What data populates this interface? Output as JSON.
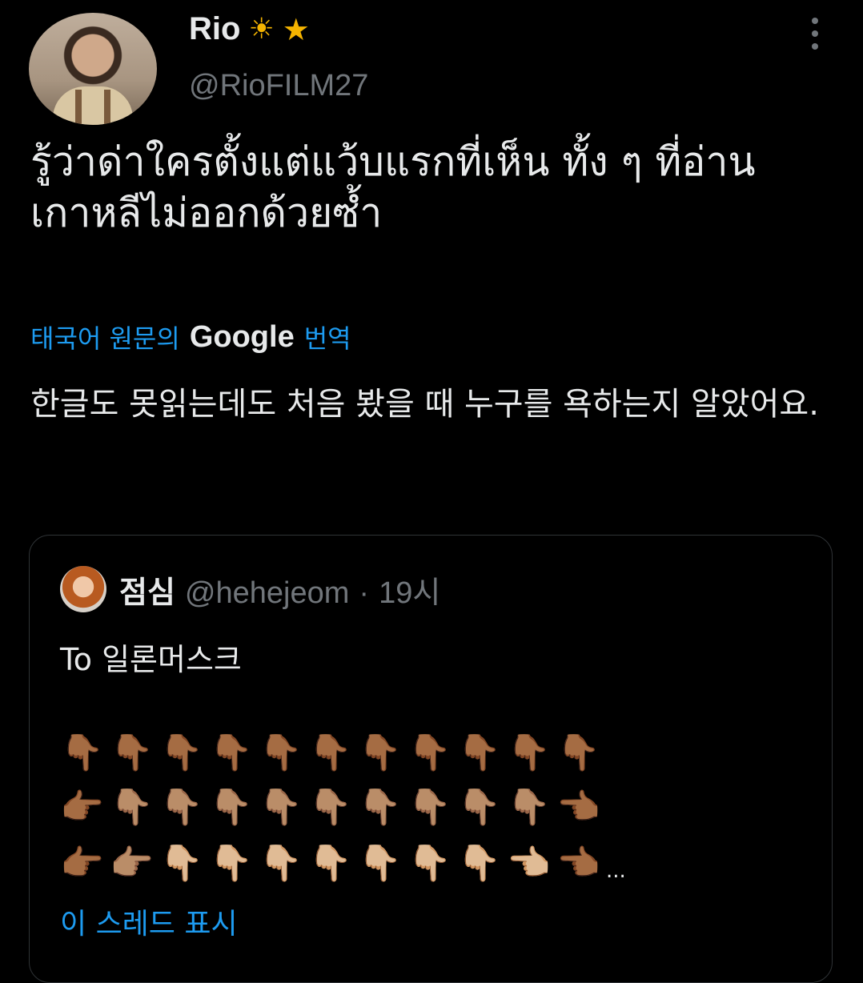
{
  "author": {
    "name": "Rio",
    "emoji_1": "☀",
    "emoji_2": "★",
    "handle": "@RioFILM27"
  },
  "tweet": {
    "text": "รู้ว่าด่าใครตั้งแต่แว้บแรกที่เห็น ทั้ง ๆ ที่อ่านเกาหลีไม่ออกด้วยซ้ำ",
    "translate_prefix": "태국어 원문의",
    "translate_brand": "Google",
    "translate_suffix": "번역",
    "translation": "한글도 못읽는데도 처음 봤을 때 누구를 욕하는지 알았어요."
  },
  "quoted": {
    "name": "점심",
    "handle": "@hehejeom",
    "separator": "·",
    "time": "19시",
    "text": "To 일론머스크",
    "emoji_rows": [
      [
        "👇🏾",
        "👇🏾",
        "👇🏾",
        "👇🏾",
        "👇🏾",
        "👇🏾",
        "👇🏾",
        "👇🏾",
        "👇🏾",
        "👇🏾",
        "👇🏾"
      ],
      [
        "👉🏾",
        "👇🏽",
        "👇🏽",
        "👇🏽",
        "👇🏽",
        "👇🏽",
        "👇🏽",
        "👇🏽",
        "👇🏽",
        "👇🏽",
        "👈🏾"
      ],
      [
        "👉🏾",
        "👉🏽",
        "👇🏼",
        "👇🏼",
        "👇🏼",
        "👇🏼",
        "👇🏼",
        "👇🏼",
        "👇🏼",
        "👈🏼",
        "👈🏾"
      ]
    ],
    "ellipsis": "...",
    "show_thread": "이 스레드 표시"
  },
  "colors": {
    "background": "#000000",
    "text": "#e7e9ea",
    "secondary": "#71767b",
    "link": "#1d9bf0",
    "border": "#2f3336"
  }
}
